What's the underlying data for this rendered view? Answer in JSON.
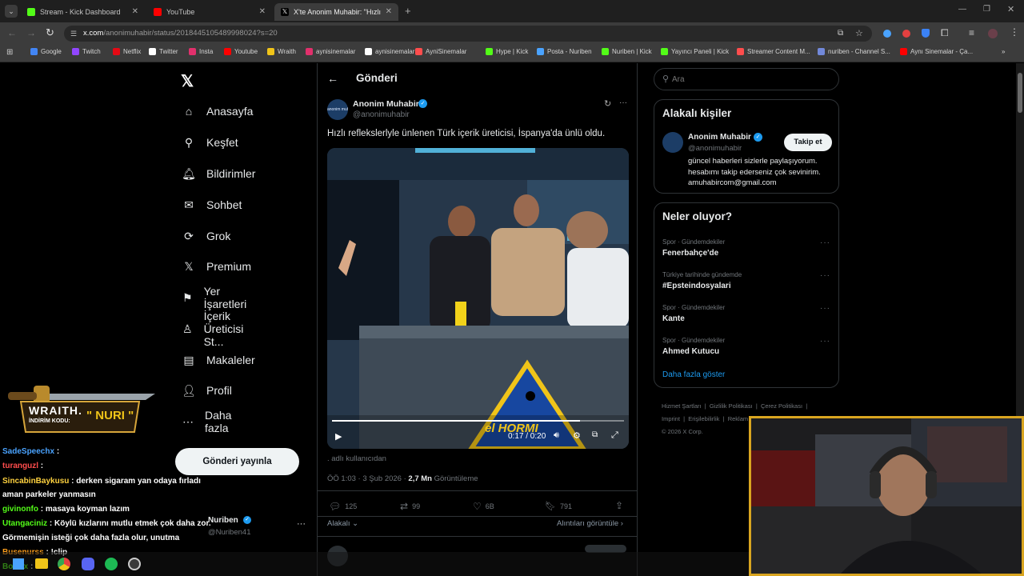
{
  "tabs": [
    {
      "title": "Stream - Kick Dashboard",
      "color": "#53fc18"
    },
    {
      "title": "YouTube",
      "color": "#ff0000"
    },
    {
      "title": "X'te Anonim Muhabir: \"Hızlı refl",
      "color": "#ffffff"
    }
  ],
  "url": {
    "domain": "x.com",
    "path": "/anonimuhabir/status/2018445105489998024?s=20"
  },
  "bookmarks": [
    "Google",
    "Twitch",
    "Netflix",
    "Twitter",
    "Insta",
    "Youtube",
    "Wraith",
    "aynisinemalar",
    "aynisinemalar",
    "AyniSinemalar",
    "Hype | Kick",
    "Posta - Nuriben",
    "Nuriben | Kick",
    "Yayıncı Paneli | Kick",
    "Streamer Content M...",
    "nuriben - Channel S...",
    "Aynı Sinemalar - Ça..."
  ],
  "nav": {
    "items": [
      "Anasayfa",
      "Keşfet",
      "Bildirimler",
      "Sohbet",
      "Grok",
      "Premium",
      "Yer İşaretleri",
      "İçerik Üreticisi St...",
      "Makaleler",
      "Profil",
      "Daha fazla"
    ],
    "post_button": "Gönderi yayınla",
    "account_name": "Nuriben",
    "account_handle": "@Nuriben41"
  },
  "post": {
    "header": "Gönderi",
    "author_name": "Anonim Muhabir",
    "author_handle": "@anonimuhabir",
    "avatar_text": "anonim muhabir",
    "text": "Hızlı reflekslerlyle ünlenen Türk içerik üreticisi, İspanya'da ünlü oldu.",
    "video_time": "0:17 / 0:20",
    "video_progress": 0.85,
    "video_logo": "el HORMI",
    "source": ". adlı kullanıcıdan",
    "timestamp": "ÖÖ 1:03 · 3 Şub 2026 ·",
    "views": "2,7 Mn",
    "views_label": "Görüntüleme",
    "replies": "125",
    "reposts": "99",
    "likes": "6B",
    "bookmarks": "791",
    "related_label": "Alakalı",
    "quotes_label": "Alıntıları görüntüle"
  },
  "search": {
    "placeholder": "Ara"
  },
  "related_people": {
    "title": "Alakalı kişiler",
    "name": "Anonim Muhabir",
    "handle": "@anonimuhabir",
    "follow": "Takip et",
    "bio": "güncel haberleri sizlerle paylaşıyorum. hesabımı takip ederseniz çok sevinirim. amuhabircom@gmail.com"
  },
  "trends": {
    "title": "Neler oluyor?",
    "items": [
      {
        "meta": "Spor · Gündemdekiler",
        "name": "Fenerbahçe'de"
      },
      {
        "meta": "Türkiye tarihinde gündemde",
        "name": "#Epsteindosyalari"
      },
      {
        "meta": "Spor · Gündemdekiler",
        "name": "Kante"
      },
      {
        "meta": "Spor · Gündemdekiler",
        "name": "Ahmed Kutucu"
      }
    ],
    "show_more": "Daha fazla göster"
  },
  "footer": {
    "links": [
      "Hizmet Şartları",
      "Gizlilik Politikası",
      "Çerez Politikası",
      "Imprint",
      "Erişilebilirlik",
      "Reklam bilgisi"
    ],
    "copyright": "© 2026 X Corp."
  },
  "overlay": {
    "sponsor_brand": "WRAITH.",
    "sponsor_code_label": "İNDİRİM KODU:",
    "sponsor_code": "\" NURI \"",
    "chat": [
      {
        "user": "SadeSpeechx",
        "msg": "",
        "color": "#4aa3ff"
      },
      {
        "user": "turanguzl",
        "msg": "",
        "color": "#ff4d4d"
      },
      {
        "user": "SincabinBaykusu",
        "msg": "derken sigaram yan odaya fırladı",
        "color": "#ffd23f"
      },
      {
        "user": "",
        "msg": "aman parkeler yanmasın",
        "color": "#ffffff"
      },
      {
        "user": "givinonfo",
        "msg": "masaya koyman lazım",
        "color": "#53fc18"
      },
      {
        "user": "Utangaciniz",
        "msg": "Köylü kızlarını mutlu etmek çok daha zor.",
        "color": "#53fc18"
      },
      {
        "user": "",
        "msg": "Görmemişin isteği çok daha fazla olur, unutma",
        "color": "#ffffff"
      },
      {
        "user": "Busenurss",
        "msg": "!clip",
        "color": "#ff9f1c"
      },
      {
        "user": "BotRix",
        "msg": "",
        "color": "#53fc18"
      }
    ]
  }
}
